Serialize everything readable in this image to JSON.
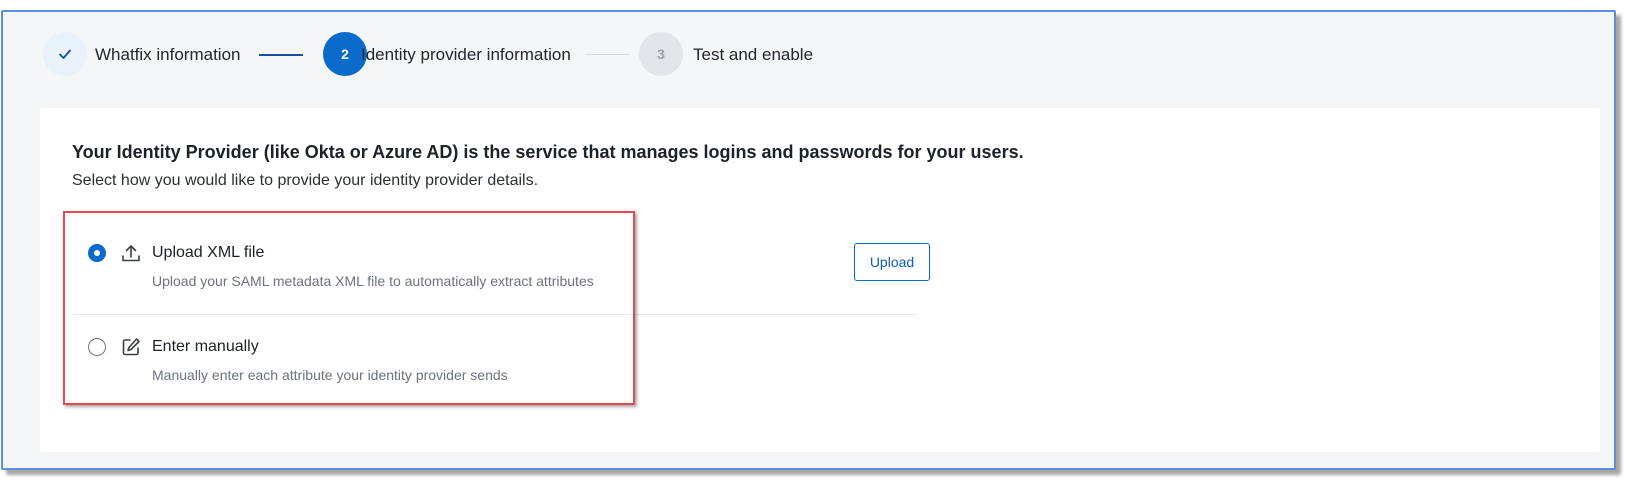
{
  "stepper": {
    "steps": [
      {
        "label": "Whatfix information",
        "state": "done",
        "icon": "check-icon"
      },
      {
        "label": "Identity provider information",
        "state": "active",
        "number": "2"
      },
      {
        "label": "Test and enable",
        "state": "pending",
        "number": "3"
      }
    ]
  },
  "card": {
    "heading": "Your Identity Provider (like Okta or Azure AD) is the service that manages logins and passwords for your users.",
    "subheading": "Select how you would like to provide your identity provider details.",
    "options": [
      {
        "title": "Upload XML file",
        "description": "Upload your SAML metadata XML file to automatically extract attributes",
        "icon": "upload-icon",
        "selected": true
      },
      {
        "title": "Enter manually",
        "description": "Manually enter each attribute your identity provider sends",
        "icon": "edit-icon",
        "selected": false
      }
    ],
    "upload_button_label": "Upload"
  },
  "colors": {
    "accent": "#0b6bcb",
    "highlight": "#e5484d",
    "page_background": "#f5f6f8"
  }
}
